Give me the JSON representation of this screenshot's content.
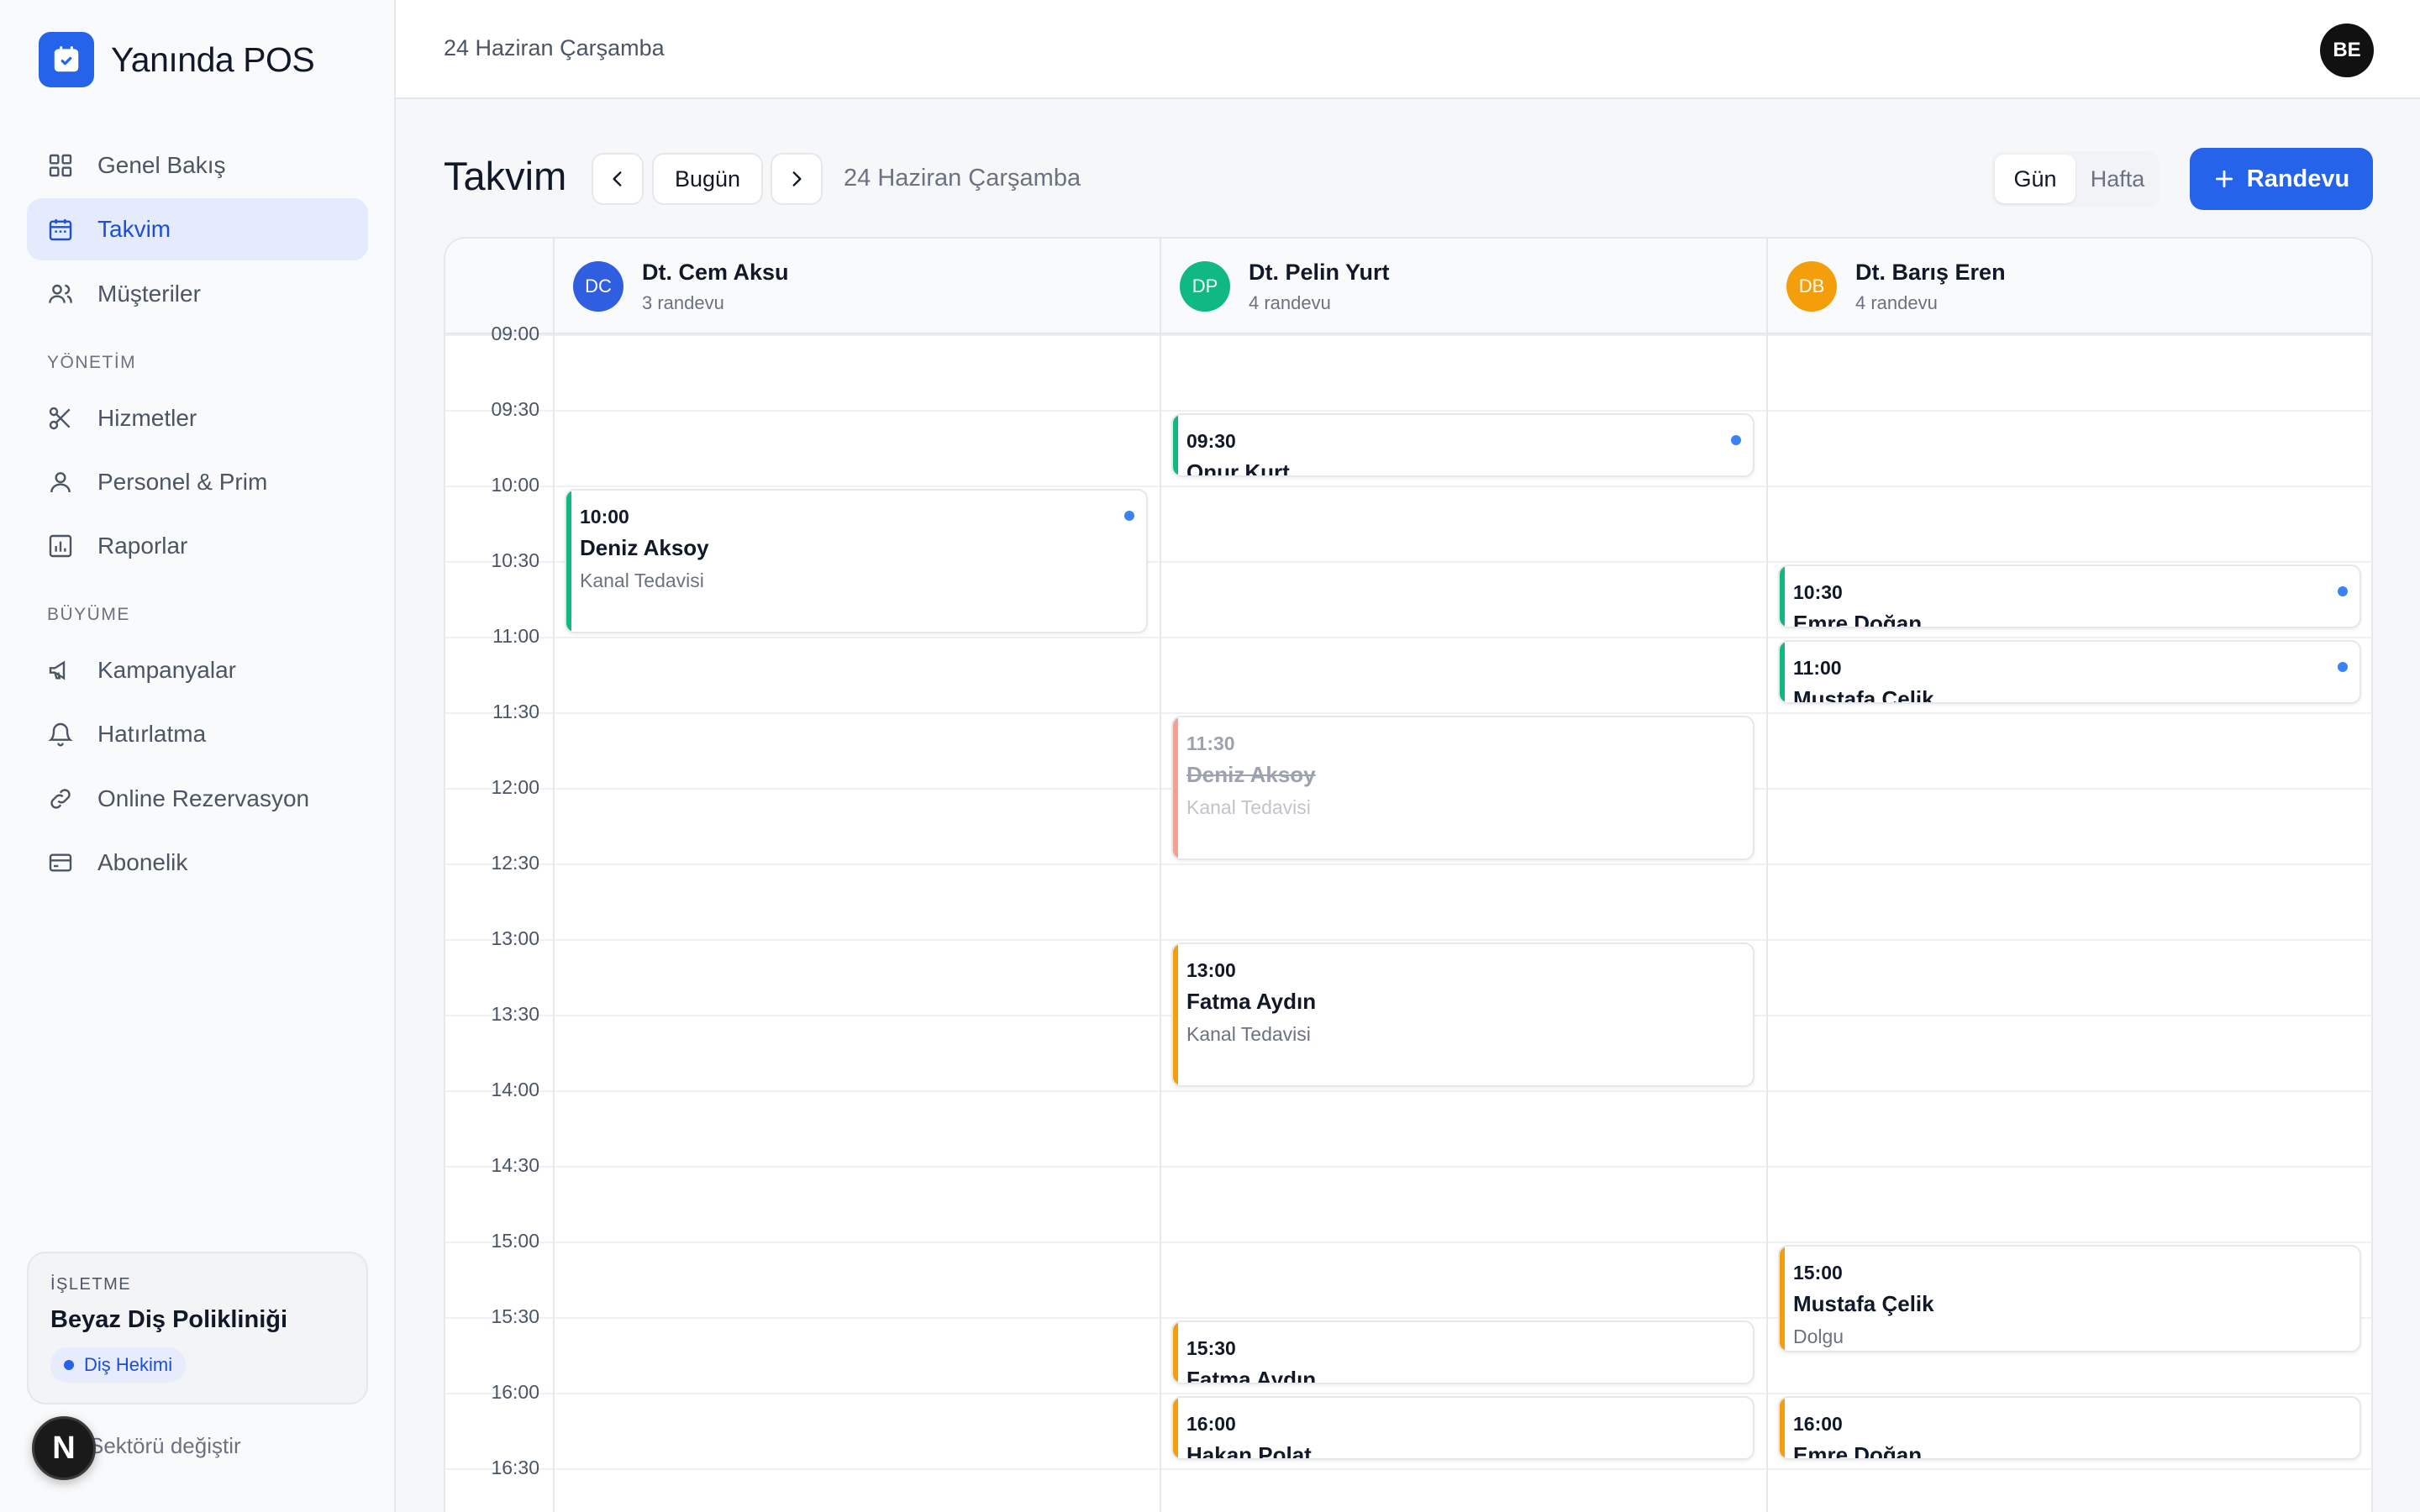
{
  "app": {
    "name": "Yanında POS"
  },
  "sidebar": {
    "items": [
      {
        "label": "Genel Bakış"
      },
      {
        "label": "Takvim"
      },
      {
        "label": "Müşteriler"
      }
    ],
    "sections": [
      {
        "title": "YÖNETİM",
        "items": [
          {
            "label": "Hizmetler"
          },
          {
            "label": "Personel & Prim"
          },
          {
            "label": "Raporlar"
          }
        ]
      },
      {
        "title": "BÜYÜME",
        "items": [
          {
            "label": "Kampanyalar"
          },
          {
            "label": "Hatırlatma"
          },
          {
            "label": "Online Rezervasyon"
          },
          {
            "label": "Abonelik"
          }
        ]
      }
    ],
    "business": {
      "label": "İŞLETME",
      "name": "Beyaz Diş Polikliniği",
      "sector": "Diş Hekimi"
    },
    "sector_switch": "Sektörü değiştir",
    "n_badge": "N"
  },
  "header": {
    "date": "24 Haziran Çarşamba",
    "avatar": "BE"
  },
  "toolbar": {
    "title": "Takvim",
    "today": "Bugün",
    "date": "24 Haziran Çarşamba",
    "view_day": "Gün",
    "view_week": "Hafta",
    "add": "Randevu"
  },
  "calendar": {
    "times": [
      "09:00",
      "09:30",
      "10:00",
      "10:30",
      "11:00",
      "11:30",
      "12:00",
      "12:30",
      "13:00",
      "13:30",
      "14:00",
      "14:30",
      "15:00",
      "15:30",
      "16:00",
      "16:30"
    ],
    "staff": [
      {
        "initials": "DC",
        "name": "Dt. Cem Aksu",
        "count": "3 randevu",
        "color": "#2f5ee0"
      },
      {
        "initials": "DP",
        "name": "Dt. Pelin Yurt",
        "count": "4 randevu",
        "color": "#10b981"
      },
      {
        "initials": "DB",
        "name": "Dt. Barış Eren",
        "count": "4 randevu",
        "color": "#f59e0b"
      }
    ],
    "appointments": [
      {
        "staff": 0,
        "time": "10:00",
        "name": "Deniz Aksoy",
        "service": "Kanal Tedavisi",
        "status": "confirmed",
        "dot": true
      },
      {
        "staff": 1,
        "time": "09:30",
        "name": "Onur Kurt",
        "service": "",
        "status": "confirmed",
        "dot": true
      },
      {
        "staff": 1,
        "time": "11:30",
        "name": "Deniz Aksoy",
        "service": "Kanal Tedavisi",
        "status": "cancelled",
        "dot": false
      },
      {
        "staff": 1,
        "time": "13:00",
        "name": "Fatma Aydın",
        "service": "Kanal Tedavisi",
        "status": "pending",
        "dot": false
      },
      {
        "staff": 1,
        "time": "15:30",
        "name": "Fatma Aydın",
        "service": "",
        "status": "pending",
        "dot": false
      },
      {
        "staff": 1,
        "time": "16:00",
        "name": "Hakan Polat",
        "service": "",
        "status": "pending",
        "dot": false
      },
      {
        "staff": 2,
        "time": "10:30",
        "name": "Emre Doğan",
        "service": "",
        "status": "confirmed",
        "dot": true
      },
      {
        "staff": 2,
        "time": "11:00",
        "name": "Mustafa Çelik",
        "service": "",
        "status": "confirmed",
        "dot": true
      },
      {
        "staff": 2,
        "time": "15:00",
        "name": "Mustafa Çelik",
        "service": "Dolgu",
        "status": "pending",
        "dot": false
      },
      {
        "staff": 2,
        "time": "16:00",
        "name": "Emre Doğan",
        "service": "",
        "status": "pending",
        "dot": false
      }
    ]
  },
  "colors": {
    "accent": "#2563eb",
    "confirmed": "#10b981",
    "pending": "#f59e0b",
    "cancelled": "#f2a091"
  }
}
